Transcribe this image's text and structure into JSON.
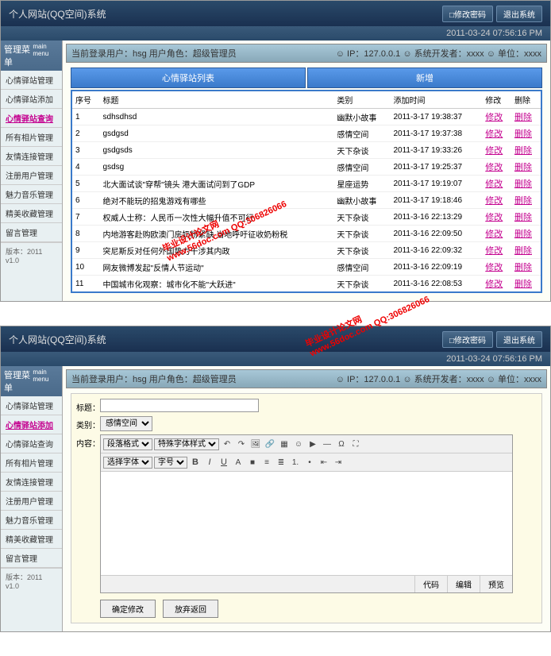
{
  "header": {
    "title": "个人网站(QQ空间)系统",
    "btn_pwd": "□修改密码",
    "btn_exit": "退出系统",
    "datetime": "2011-03-24 07:56:16 PM"
  },
  "topbar": {
    "left": "当前登录用户：hsg  用户角色：超级管理员",
    "right": "☺ IP：127.0.0.1   ☺ 系统开发者：xxxx   ☺ 单位：xxxx"
  },
  "sidebar": {
    "head": "管理菜单",
    "head_en": "main menu",
    "items": [
      {
        "label": "心情驿站管理"
      },
      {
        "label": "心情驿站添加"
      },
      {
        "label": "心情驿站查询",
        "active": true
      },
      {
        "label": "所有相片管理"
      },
      {
        "label": "友情连接管理"
      },
      {
        "label": "注册用户管理"
      },
      {
        "label": "魅力音乐管理"
      },
      {
        "label": "精美收藏管理"
      },
      {
        "label": "留言管理"
      }
    ],
    "footer": "版本：2011 v1.0"
  },
  "tabs": {
    "list": "心情驿站列表",
    "add": "新增"
  },
  "cols": {
    "no": "序号",
    "title": "标题",
    "type": "类别",
    "time": "添加时间",
    "edit": "修改",
    "del": "删除"
  },
  "link": {
    "edit": "修改",
    "del": "删除"
  },
  "rows": [
    {
      "no": "1",
      "title": "sdhsdhsd",
      "type": "幽默小故事",
      "time": "2011-3-17 19:38:37"
    },
    {
      "no": "2",
      "title": "gsdgsd",
      "type": "感情空间",
      "time": "2011-3-17 19:37:38"
    },
    {
      "no": "3",
      "title": "gsdgsds",
      "type": "天下杂谈",
      "time": "2011-3-17 19:33:26"
    },
    {
      "no": "4",
      "title": "gsdsg",
      "type": "感情空间",
      "time": "2011-3-17 19:25:37"
    },
    {
      "no": "5",
      "title": "北大面试谈\"穿帮\"镜头 港大面试问到了GDP",
      "type": "星座运势",
      "time": "2011-3-17 19:19:07"
    },
    {
      "no": "6",
      "title": "绝对不能玩的招鬼游戏有哪些",
      "type": "幽默小故事",
      "time": "2011-3-17 19:18:46"
    },
    {
      "no": "7",
      "title": "权威人士称：人民币一次性大幅升值不可行",
      "type": "天下杂谈",
      "time": "2011-3-16 22:13:29"
    },
    {
      "no": "8",
      "title": "内地游客赴购欧澳门房奶粉紧缺 当地呼吁征收奶粉税",
      "type": "天下杂谈",
      "time": "2011-3-16 22:09:50"
    },
    {
      "no": "9",
      "title": "突尼斯反对任何外国势力干涉其内政",
      "type": "天下杂谈",
      "time": "2011-3-16 22:09:32"
    },
    {
      "no": "10",
      "title": "网友微博发起\"反情人节运动\"",
      "type": "感情空间",
      "time": "2011-3-16 22:09:19"
    },
    {
      "no": "11",
      "title": "中国城市化观察：城市化不能\"大跃进\"",
      "type": "天下杂谈",
      "time": "2011-3-16 22:08:53"
    }
  ],
  "form": {
    "title_label": "标题：",
    "type_label": "类别：",
    "type_value": "感情空间",
    "content_label": "内容：",
    "para": "段落格式",
    "font_style": "特殊字体样式",
    "font_family": "选择字体",
    "font_size": "字号",
    "tab_code": "代码",
    "tab_edit": "编辑",
    "tab_view": "预览",
    "btn_ok": "确定修改",
    "btn_back": "放弃返回"
  },
  "sidebar2_active": "心情驿站添加",
  "watermark": {
    "txt1": "毕业设计论文网",
    "txt2": "www.56doc.com   QQ:306826066"
  }
}
